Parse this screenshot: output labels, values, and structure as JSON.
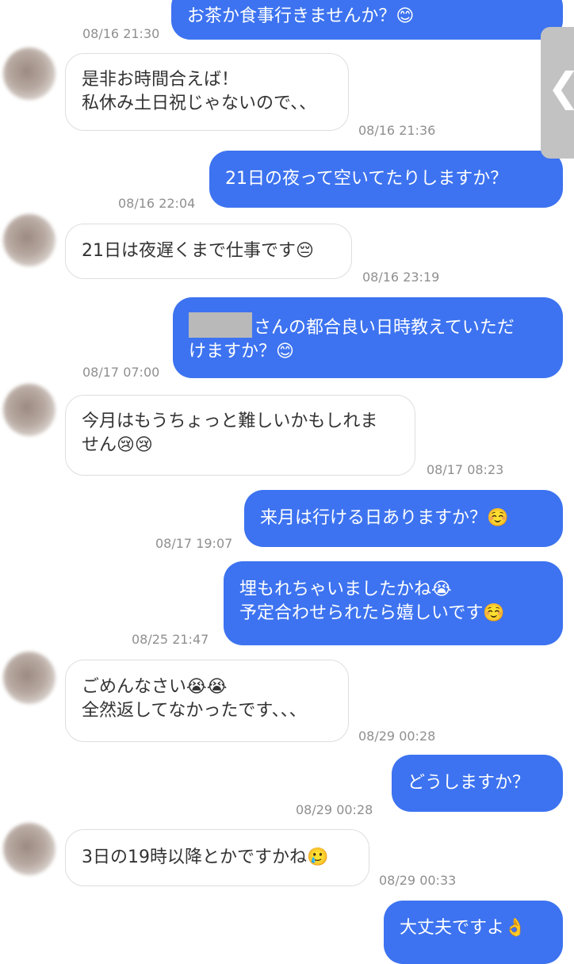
{
  "messages": [
    {
      "dir": "out",
      "lines": [
        "お茶か食事行きませんか？😊"
      ],
      "time": "08/16 21:30"
    },
    {
      "dir": "in",
      "lines": [
        "是非お時間合えば！",
        "私休み土日祝じゃないので、、"
      ],
      "time": "08/16 21:36"
    },
    {
      "dir": "out",
      "lines": [
        "21日の夜って空いてたりしますか？"
      ],
      "time": "08/16 22:04"
    },
    {
      "dir": "in",
      "lines": [
        "21日は夜遅くまで仕事です😔"
      ],
      "time": "08/16 23:19"
    },
    {
      "dir": "out",
      "lines": [
        "さんの都合良い日時教えていただ",
        "けますか？😊"
      ],
      "time": "08/17 07:00"
    },
    {
      "dir": "in",
      "lines": [
        "今月はもうちょっと難しいかもしれま",
        "せん😢😢"
      ],
      "time": "08/17 08:23"
    },
    {
      "dir": "out",
      "lines": [
        "来月は行ける日ありますか？☺️"
      ],
      "time": "08/17 19:07"
    },
    {
      "dir": "out",
      "lines": [
        "埋もれちゃいましたかね😭",
        "予定合わせられたら嬉しいです☺️"
      ],
      "time": "08/25 21:47"
    },
    {
      "dir": "in",
      "lines": [
        "ごめんなさい😭😭",
        "全然返してなかったです、、、"
      ],
      "time": "08/29 00:28"
    },
    {
      "dir": "out",
      "lines": [
        "どうしますか？"
      ],
      "time": "08/29 00:28"
    },
    {
      "dir": "in",
      "lines": [
        "3日の19時以降とかですかね🥲"
      ],
      "time": "08/29 00:33"
    },
    {
      "dir": "out",
      "lines": [
        "大丈夫ですよ👌"
      ],
      "time": ""
    }
  ],
  "side_tab": {
    "icon": "chevron-left-icon",
    "glyph": "❮"
  },
  "colors": {
    "outgoing": "#3d73f0",
    "incoming_border": "#dedede",
    "timestamp": "#8f8f8f"
  }
}
